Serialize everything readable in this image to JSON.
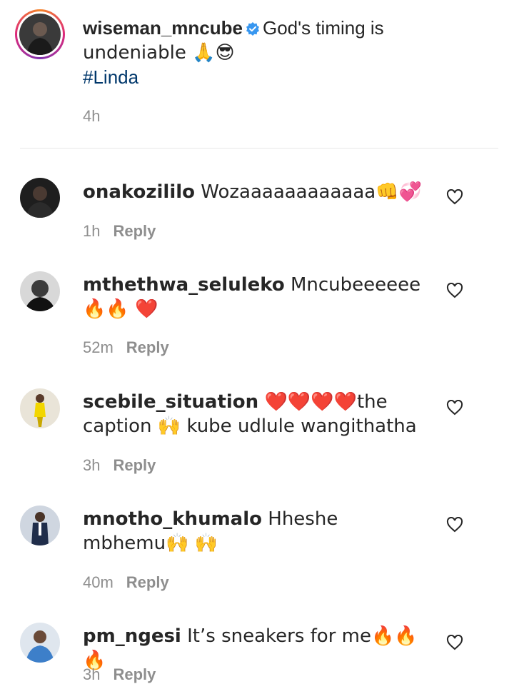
{
  "post": {
    "username": "wiseman_mncube",
    "caption_line1": "God's timing is",
    "caption_line2": "undeniable 🙏😎",
    "hashtag": "#Linda",
    "time": "4h"
  },
  "comments": [
    {
      "username": "onakozililo",
      "text": "Wozaaaaaaaaaaaa👊💞",
      "time": "1h",
      "reply": "Reply"
    },
    {
      "username": "mthethwa_seluleko",
      "text": "Mncubeeeeee🔥🔥 ❤️",
      "time": "52m",
      "reply": "Reply"
    },
    {
      "username": "scebile_situation",
      "text": "❤️❤️❤️❤️the caption 🙌 kube udlule wangithatha",
      "time": "3h",
      "reply": "Reply"
    },
    {
      "username": "mnotho_khumalo",
      "text": "Hheshe mbhemu🙌 🙌",
      "time": "40m",
      "reply": "Reply"
    },
    {
      "username": "pm_ngesi",
      "text": "It’s sneakers for me🔥🔥🔥",
      "time": "3h",
      "reply": "Reply"
    }
  ],
  "icons": {
    "verified": "verified-badge-icon",
    "like": "heart-outline-icon"
  },
  "colors": {
    "text": "#262626",
    "muted": "#8e8e8e",
    "hashtag": "#00376b",
    "verified": "#3897f0",
    "divider": "#e8e8e8"
  }
}
